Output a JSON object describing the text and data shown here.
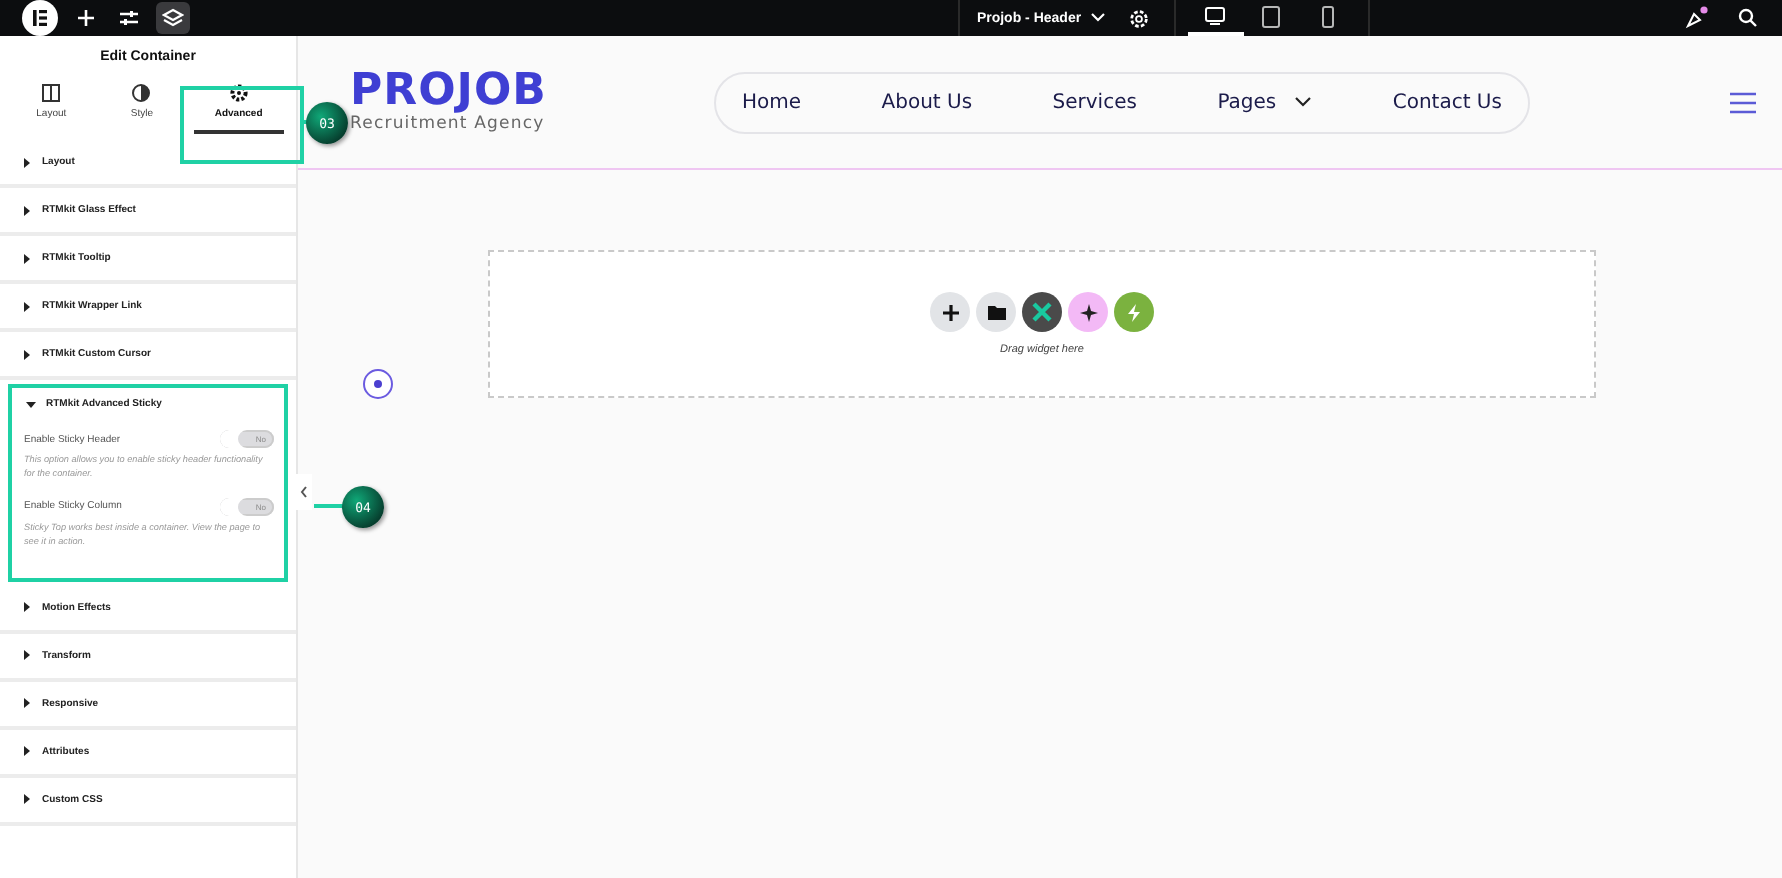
{
  "topbar": {
    "document_title": "Projob - Header",
    "devices": [
      {
        "kind": "desktop",
        "selected": true
      },
      {
        "kind": "tablet",
        "selected": false
      },
      {
        "kind": "mobile",
        "selected": false
      }
    ]
  },
  "sidebar": {
    "title": "Edit Container",
    "tabs": [
      {
        "kind": "layout",
        "label": "Layout",
        "selected": false
      },
      {
        "kind": "style",
        "label": "Style",
        "selected": false
      },
      {
        "kind": "advanced",
        "label": "Advanced",
        "selected": true
      }
    ],
    "sections": [
      {
        "label": "Layout",
        "expanded": false
      },
      {
        "label": "RTMkit Glass Effect",
        "expanded": false
      },
      {
        "label": "RTMkit Tooltip",
        "expanded": false
      },
      {
        "label": "RTMkit Wrapper Link",
        "expanded": false
      },
      {
        "label": "RTMkit Custom Cursor",
        "expanded": false
      },
      {
        "label": "RTMkit Advanced Sticky",
        "expanded": true,
        "highlighted": true,
        "controls": [
          {
            "label": "Enable Sticky Header",
            "on": false,
            "state_label": "No",
            "description": "This option allows you to enable sticky header functionality for the container."
          },
          {
            "label": "Enable Sticky Column",
            "on": false,
            "state_label": "No",
            "description": "Sticky Top works best inside a container. View the page to see it in action."
          }
        ]
      },
      {
        "label": "Motion Effects",
        "expanded": false
      },
      {
        "label": "Transform",
        "expanded": false
      },
      {
        "label": "Responsive",
        "expanded": false
      },
      {
        "label": "Attributes",
        "expanded": false
      },
      {
        "label": "Custom CSS",
        "expanded": false
      }
    ]
  },
  "canvas": {
    "logo": "PROJOB",
    "tagline": "Recruitment Agency",
    "nav": [
      {
        "label": "Home",
        "has_dropdown": false
      },
      {
        "label": "About Us",
        "has_dropdown": false
      },
      {
        "label": "Services",
        "has_dropdown": false
      },
      {
        "label": "Pages",
        "has_dropdown": true
      },
      {
        "label": "Contact Us",
        "has_dropdown": false
      }
    ],
    "dropzone": {
      "hint": "Drag widget here"
    }
  },
  "callouts": [
    {
      "label": "03"
    },
    {
      "label": "04"
    }
  ]
}
